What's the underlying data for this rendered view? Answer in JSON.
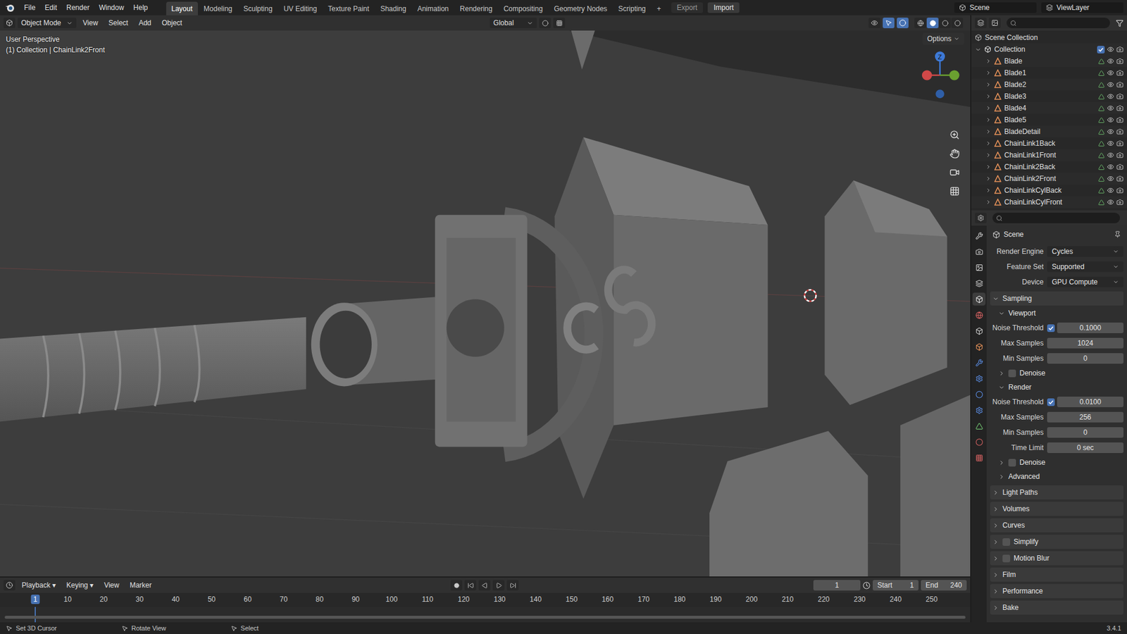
{
  "topbar": {
    "menus": [
      "File",
      "Edit",
      "Render",
      "Window",
      "Help"
    ],
    "workspaces": [
      {
        "label": "Layout",
        "selected": true
      },
      {
        "label": "Modeling",
        "selected": false
      },
      {
        "label": "Sculpting",
        "selected": false
      },
      {
        "label": "UV Editing",
        "selected": false
      },
      {
        "label": "Texture Paint",
        "selected": false
      },
      {
        "label": "Shading",
        "selected": false
      },
      {
        "label": "Animation",
        "selected": false
      },
      {
        "label": "Rendering",
        "selected": false
      },
      {
        "label": "Compositing",
        "selected": false
      },
      {
        "label": "Geometry Nodes",
        "selected": false
      },
      {
        "label": "Scripting",
        "selected": false
      }
    ],
    "add_tab": "+",
    "export": "Export",
    "import": "Import",
    "scene": "Scene",
    "view_layer": "ViewLayer"
  },
  "viewport": {
    "mode": "Object Mode",
    "menus": [
      "View",
      "Select",
      "Add",
      "Object"
    ],
    "transform": "Global",
    "options": "Options",
    "overlay_title": "User Perspective",
    "overlay_object": "(1) Collection | ChainLink2Front",
    "gizmo_axis": "Z"
  },
  "outliner": {
    "root": "Scene Collection",
    "collection": {
      "name": "Collection",
      "checked": true
    },
    "items": [
      "Blade",
      "Blade1",
      "Blade2",
      "Blade3",
      "Blade4",
      "Blade5",
      "BladeDetail",
      "ChainLink1Back",
      "ChainLink1Front",
      "ChainLink2Back",
      "ChainLink2Front",
      "ChainLinkCylBack",
      "ChainLinkCylFront"
    ]
  },
  "properties": {
    "title": "Scene",
    "rows": [
      {
        "kind": "dropdown",
        "label": "Render Engine",
        "value": "Cycles"
      },
      {
        "kind": "dropdown",
        "label": "Feature Set",
        "value": "Supported"
      },
      {
        "kind": "dropdown",
        "label": "Device",
        "value": "GPU Compute"
      },
      {
        "kind": "panel",
        "label": "Sampling",
        "expanded": true
      },
      {
        "kind": "subpanel",
        "label": "Viewport",
        "expanded": true
      },
      {
        "kind": "toggle-number",
        "label": "Noise Threshold",
        "checked": true,
        "value": "0.1000"
      },
      {
        "kind": "number",
        "label": "Max Samples",
        "value": "1024"
      },
      {
        "kind": "number",
        "label": "Min Samples",
        "value": "0"
      },
      {
        "kind": "check-subpanel",
        "label": "Denoise",
        "checked": false,
        "expanded": false
      },
      {
        "kind": "subpanel",
        "label": "Render",
        "expanded": true
      },
      {
        "kind": "toggle-number",
        "label": "Noise Threshold",
        "checked": true,
        "value": "0.0100"
      },
      {
        "kind": "number",
        "label": "Max Samples",
        "value": "256"
      },
      {
        "kind": "number",
        "label": "Min Samples",
        "value": "0"
      },
      {
        "kind": "number",
        "label": "Time Limit",
        "value": "0 sec"
      },
      {
        "kind": "check-subpanel",
        "label": "Denoise",
        "checked": false,
        "expanded": false
      },
      {
        "kind": "subpanel",
        "label": "Advanced",
        "expanded": false
      },
      {
        "kind": "panel",
        "label": "Light Paths",
        "expanded": false
      },
      {
        "kind": "panel",
        "label": "Volumes",
        "expanded": false
      },
      {
        "kind": "panel",
        "label": "Curves",
        "expanded": false
      },
      {
        "kind": "check-panel",
        "label": "Simplify",
        "checked": false,
        "expanded": false
      },
      {
        "kind": "check-panel",
        "label": "Motion Blur",
        "checked": false,
        "expanded": false
      },
      {
        "kind": "panel",
        "label": "Film",
        "expanded": false
      },
      {
        "kind": "panel",
        "label": "Performance",
        "expanded": false
      },
      {
        "kind": "panel",
        "label": "Bake",
        "expanded": false
      }
    ]
  },
  "timeline": {
    "menus": [
      "Playback",
      "Keying",
      "View",
      "Marker"
    ],
    "current_frame": "1",
    "start_label": "Start",
    "start": "1",
    "end_label": "End",
    "end": "240",
    "ruler": [
      {
        "label": "1",
        "selected": true
      },
      {
        "label": "10",
        "selected": false
      },
      {
        "label": "20",
        "selected": false
      },
      {
        "label": "30",
        "selected": false
      },
      {
        "label": "40",
        "selected": false
      },
      {
        "label": "50",
        "selected": false
      },
      {
        "label": "60",
        "selected": false
      },
      {
        "label": "70",
        "selected": false
      },
      {
        "label": "80",
        "selected": false
      },
      {
        "label": "90",
        "selected": false
      },
      {
        "label": "100",
        "selected": false
      },
      {
        "label": "110",
        "selected": false
      },
      {
        "label": "120",
        "selected": false
      },
      {
        "label": "130",
        "selected": false
      },
      {
        "label": "140",
        "selected": false
      },
      {
        "label": "150",
        "selected": false
      },
      {
        "label": "160",
        "selected": false
      },
      {
        "label": "170",
        "selected": false
      },
      {
        "label": "180",
        "selected": false
      },
      {
        "label": "190",
        "selected": false
      },
      {
        "label": "200",
        "selected": false
      },
      {
        "label": "210",
        "selected": false
      },
      {
        "label": "220",
        "selected": false
      },
      {
        "label": "230",
        "selected": false
      },
      {
        "label": "240",
        "selected": false
      },
      {
        "label": "250",
        "selected": false
      }
    ]
  },
  "status_bar": {
    "hints": [
      "Set 3D Cursor",
      "Rotate View",
      "Select"
    ],
    "version": "3.4.1"
  }
}
